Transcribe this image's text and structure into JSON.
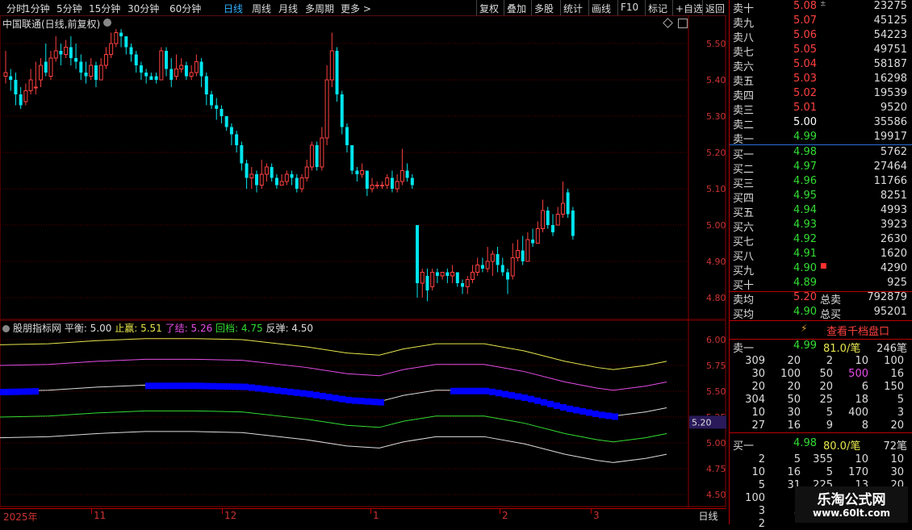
{
  "toolbar": {
    "periods": [
      "分时",
      "1分钟",
      "5分钟",
      "15分钟",
      "30分钟",
      "60分钟",
      "日线",
      "周线",
      "月线",
      "多周期",
      "更多 >"
    ],
    "active": "日线",
    "right_buttons": [
      "复权",
      "叠加",
      "多股",
      "统计",
      "画线",
      "F10",
      "标记",
      "+自选",
      "返回"
    ]
  },
  "stock": {
    "title": "中国联通(日线,前复权)"
  },
  "main_axis": {
    "ticks": [
      "5.50",
      "5.40",
      "5.30",
      "5.20",
      "5.10",
      "5.00",
      "4.90",
      "4.80"
    ]
  },
  "indicator": {
    "name": "股朋指标网",
    "items": [
      {
        "label": "平衡:",
        "value": "5.00",
        "color": "#dddddd"
      },
      {
        "label": "止赢:",
        "value": "5.51",
        "color": "#e6e64d"
      },
      {
        "label": "了结:",
        "value": "5.26",
        "color": "#e64de6"
      },
      {
        "label": "回档:",
        "value": "4.75",
        "color": "#33dd33"
      },
      {
        "label": "反弹:",
        "value": "4.50",
        "color": "#dddddd"
      }
    ],
    "ticks": [
      "6.00",
      "5.75",
      "5.50",
      "5.25",
      "5.00",
      "4.75",
      "4.50"
    ],
    "marker": "5.20"
  },
  "dates": [
    "2025年",
    "11",
    "12",
    "1",
    "2",
    "3"
  ],
  "period_label": "日线",
  "colors": {
    "up": "#ff4040",
    "down": "#00e5ee",
    "grid": "#5a0000",
    "band_up": "#e6e64d",
    "band_mid": "#e64de6",
    "band_green": "#33dd33",
    "band_fill": "#0000ff"
  },
  "orderbook": {
    "sells": [
      {
        "label": "卖十",
        "price": "5.08",
        "vol": "23275",
        "mark": "±"
      },
      {
        "label": "卖九",
        "price": "5.07",
        "vol": "45125",
        "mark": ""
      },
      {
        "label": "卖八",
        "price": "5.06",
        "vol": "54223",
        "mark": ""
      },
      {
        "label": "卖七",
        "price": "5.05",
        "vol": "49751",
        "mark": ""
      },
      {
        "label": "卖六",
        "price": "5.04",
        "vol": "58187",
        "mark": ""
      },
      {
        "label": "卖五",
        "price": "5.03",
        "vol": "16298",
        "mark": ""
      },
      {
        "label": "卖四",
        "price": "5.02",
        "vol": "19539",
        "mark": ""
      },
      {
        "label": "卖三",
        "price": "5.01",
        "vol": "9520",
        "mark": ""
      },
      {
        "label": "卖二",
        "price": "5.00",
        "vol": "35586",
        "mark": ""
      },
      {
        "label": "卖一",
        "price": "4.99",
        "vol": "19917",
        "mark": ""
      }
    ],
    "buys": [
      {
        "label": "买一",
        "price": "4.98",
        "vol": "5762",
        "mark": ""
      },
      {
        "label": "买二",
        "price": "4.97",
        "vol": "27464",
        "mark": ""
      },
      {
        "label": "买三",
        "price": "4.96",
        "vol": "11766",
        "mark": ""
      },
      {
        "label": "买四",
        "price": "4.95",
        "vol": "8251",
        "mark": ""
      },
      {
        "label": "买五",
        "price": "4.94",
        "vol": "4993",
        "mark": ""
      },
      {
        "label": "买六",
        "price": "4.93",
        "vol": "3923",
        "mark": ""
      },
      {
        "label": "买七",
        "price": "4.92",
        "vol": "2630",
        "mark": ""
      },
      {
        "label": "买八",
        "price": "4.91",
        "vol": "1620",
        "mark": ""
      },
      {
        "label": "买九",
        "price": "4.90",
        "vol": "4290",
        "mark": "■"
      },
      {
        "label": "买十",
        "price": "4.89",
        "vol": "925",
        "mark": ""
      }
    ],
    "avg_sell": {
      "label": "卖均",
      "price": "5.20",
      "total_label": "总卖",
      "total": "792879"
    },
    "avg_buy": {
      "label": "买均",
      "price": "4.90",
      "total_label": "总买",
      "total": "95201"
    },
    "thousand_button": "查看千档盘口",
    "sell1": {
      "label": "卖一",
      "price": "4.99",
      "avg": "81.0/笔",
      "count": "246笔"
    },
    "sell_queue": [
      [
        "309",
        "20",
        "2",
        "10",
        "100"
      ],
      [
        "30",
        "100",
        "50",
        "500",
        "16"
      ],
      [
        "20",
        "20",
        "20",
        "6",
        "150"
      ],
      [
        "304",
        "50",
        "25",
        "18",
        "5"
      ],
      [
        "10",
        "30",
        "5",
        "400",
        "3"
      ],
      [
        "27",
        "16",
        "9",
        "8",
        "20"
      ]
    ],
    "buy1": {
      "label": "买一",
      "price": "4.98",
      "avg": "80.0/笔",
      "count": "72笔"
    },
    "buy_queue": [
      [
        "2",
        "5",
        "355",
        "10",
        "10"
      ],
      [
        "10",
        "16",
        "5",
        "170",
        "30"
      ],
      [
        "5",
        "31",
        "225",
        "13",
        "20"
      ],
      [
        "100",
        "",
        "",
        "",
        "10"
      ],
      [
        "3",
        "5",
        "",
        "",
        ""
      ],
      [
        "2",
        "",
        "",
        "",
        ""
      ]
    ]
  },
  "watermark": {
    "line1": "乐淘公式网",
    "line2": "www.60lt.com"
  }
}
